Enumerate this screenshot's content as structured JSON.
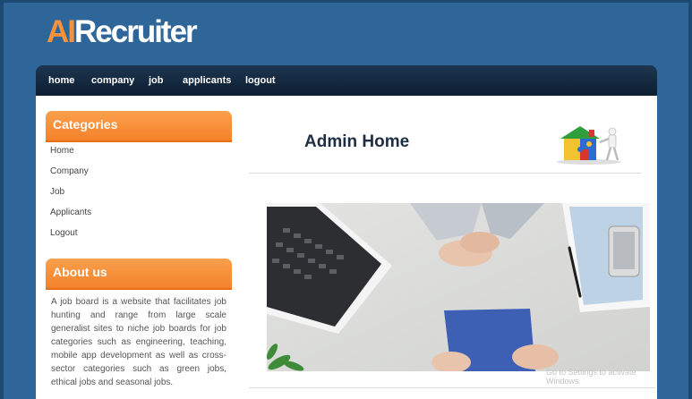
{
  "logo": {
    "part1": "AI",
    "part2": "Recruiter"
  },
  "nav": [
    "home",
    "company",
    "job",
    "applicants",
    "logout"
  ],
  "sidebar": {
    "categories_title": "Categories",
    "categories": [
      "Home",
      "Company",
      "Job",
      "Applicants",
      "Logout"
    ],
    "about_title": "About us",
    "about_text": "A job board is a website that facilitates job hunting and range from large scale generalist sites to niche job boards for job categories such as engineering, teaching, mobile app development as well as cross-sector categories such as green jobs, ethical jobs and seasonal jobs."
  },
  "main": {
    "title": "Admin Home",
    "watermark": "Go to Settings to activate Windows."
  },
  "icons": {
    "header": "puzzle-house-icon",
    "photo": "desk-laptop-photo"
  },
  "colors": {
    "accent": "#f5822a",
    "background": "#2f6699",
    "nav": "#0c1e31"
  }
}
